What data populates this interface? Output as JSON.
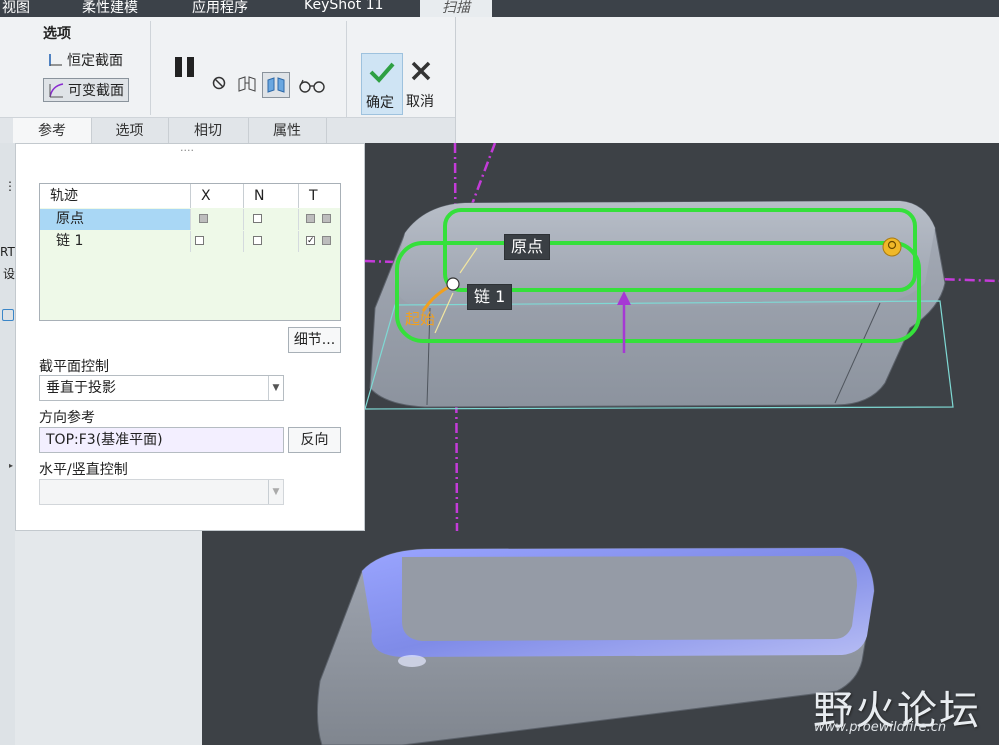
{
  "menu": {
    "tabs": [
      "视图",
      "柔性建模",
      "应用程序",
      "KeyShot 11",
      "扫描"
    ]
  },
  "ribbon": {
    "group_label": "选项",
    "constant_section": "恒定截面",
    "variable_section": "可变截面",
    "ok": "确定",
    "cancel": "取消"
  },
  "subtabs": [
    "参考",
    "选项",
    "相切",
    "属性"
  ],
  "panel": {
    "grip": "····",
    "table": {
      "headers": [
        "轨迹",
        "X",
        "N",
        "T"
      ],
      "rows": [
        {
          "name": "原点",
          "x": "gray",
          "n": "empty",
          "t": [
            "gray",
            "gray"
          ]
        },
        {
          "name": "链 1",
          "x": "empty",
          "n": "empty",
          "t": [
            "checked",
            "gray"
          ]
        }
      ]
    },
    "details_button": "细节...",
    "section_control_label": "截平面控制",
    "section_control_value": "垂直于投影",
    "direction_ref_label": "方向参考",
    "direction_ref_value": "TOP:F3(基准平面)",
    "flip_button": "反向",
    "hv_control_label": "水平/竖直控制",
    "hv_control_value": ""
  },
  "left_strip": {
    "texts": [
      "RT",
      "设"
    ]
  },
  "viewport": {
    "tag_origin": "原点",
    "tag_chain": "链 1",
    "start_label": "起始"
  },
  "watermark": {
    "title": "野火论坛",
    "url": "www.proewildfire.cn"
  },
  "colors": {
    "trajectory": "#35e03b",
    "datum": "#c43bd9",
    "accent_orange": "#f0a020",
    "viewport_bg": "#3d4146"
  }
}
